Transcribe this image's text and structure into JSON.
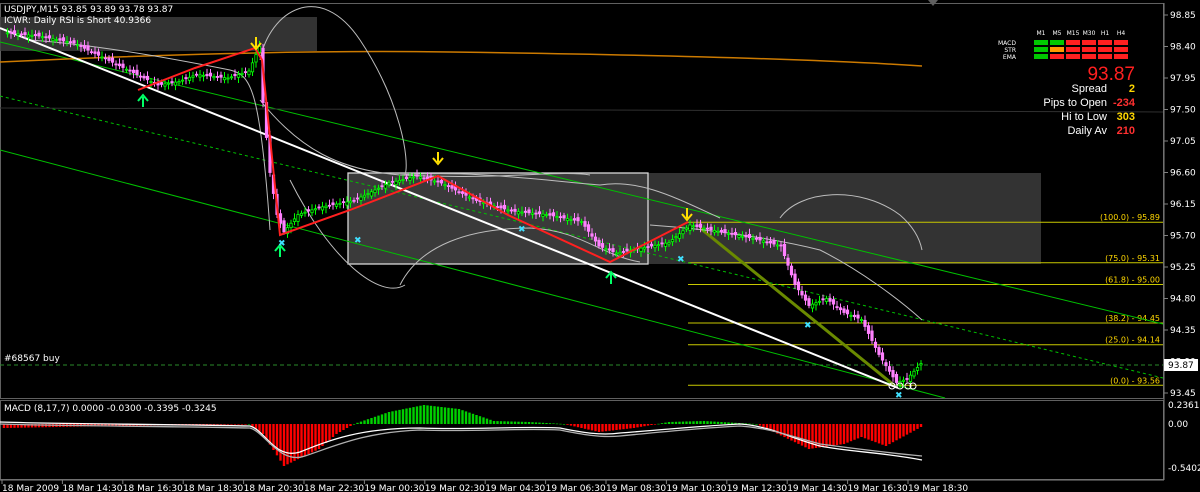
{
  "header": {
    "symbol_line": "USDJPY,M15  93.85 93.89 93.78 93.87",
    "rsi_line": "ICWR: Daily RSI is Short 40.9366"
  },
  "order_label": "#68567 buy",
  "macd": {
    "label": "MACD  (8,17,7) 0.0000 -0.0300 -0.3395 -0.3245",
    "axis": [
      "0.2361",
      "0.00",
      "-0.5402"
    ]
  },
  "panel": {
    "timeframes": [
      "M1",
      "M5",
      "M15",
      "M30",
      "H1",
      "H4"
    ],
    "rows": [
      {
        "name": "MACD",
        "colors": [
          "#00c800",
          "#00c800",
          "#ff2020",
          "#ff2020",
          "#ff2020",
          "#ff2020"
        ]
      },
      {
        "name": "STR",
        "colors": [
          "#00c800",
          "#ff9900",
          "#ff2020",
          "#ff2020",
          "#ff2020",
          "#ff2020"
        ]
      },
      {
        "name": "EMA",
        "colors": [
          "#00c800",
          "#ff2020",
          "#ff2020",
          "#ff2020",
          "#ff2020",
          "#ff2020"
        ]
      }
    ],
    "price": "93.87",
    "stats": [
      {
        "label": "Spread",
        "value": "2",
        "color": "#ffd700"
      },
      {
        "label": "Pips to Open",
        "value": "-234",
        "color": "#ff3030"
      },
      {
        "label": "Hi to Low",
        "value": "303",
        "color": "#ffd700"
      },
      {
        "label": "Daily Av",
        "value": "210",
        "color": "#ff3030"
      }
    ]
  },
  "fib_levels": [
    {
      "label": "(100.0) - 95.89",
      "price": 95.89
    },
    {
      "label": "(75.0) - 95.31",
      "price": 95.31
    },
    {
      "label": "(61.8) - 95.00",
      "price": 95.0
    },
    {
      "label": "(38.2) - 94.45",
      "price": 94.45
    },
    {
      "label": "(25.0) - 94.14",
      "price": 94.14
    },
    {
      "label": "(0.0) - 93.56",
      "price": 93.56
    }
  ],
  "colors": {
    "bull": "#00ff00",
    "bear": "#ff80ff",
    "zigzag": "#ff2020",
    "trend": "#00c000",
    "fib": "#c8c800",
    "ema": "#cc7a00",
    "macd_pos": "#00d000",
    "macd_neg": "#ff0000"
  },
  "chart_data": {
    "type": "candlestick",
    "price_axis": [
      "98.85",
      "98.40",
      "97.95",
      "97.50",
      "97.05",
      "96.60",
      "96.15",
      "95.70",
      "95.25",
      "94.80",
      "94.35",
      "93.90",
      "93.45"
    ],
    "price_tag": "93.87",
    "time_axis": [
      "18 Mar 2009",
      "18 Mar 14:30",
      "18 Mar 16:30",
      "18 Mar 18:30",
      "18 Mar 20:30",
      "18 Mar 22:30",
      "19 Mar 00:30",
      "19 Mar 02:30",
      "19 Mar 04:30",
      "19 Mar 06:30",
      "19 Mar 08:30",
      "19 Mar 10:30",
      "19 Mar 12:30",
      "19 Mar 14:30",
      "19 Mar 16:30",
      "19 Mar 18:30"
    ],
    "ylim": [
      93.3,
      98.95
    ],
    "price_series": [
      {
        "x": 0,
        "price": 98.6
      },
      {
        "x": 10,
        "price": 98.55
      },
      {
        "x": 20,
        "price": 98.45
      },
      {
        "x": 30,
        "price": 98.2
      },
      {
        "x": 40,
        "price": 97.95
      },
      {
        "x": 44,
        "price": 97.85
      },
      {
        "x": 50,
        "price": 97.9
      },
      {
        "x": 55,
        "price": 98.0
      },
      {
        "x": 64,
        "price": 97.95
      },
      {
        "x": 70,
        "price": 98.05
      },
      {
        "x": 73,
        "price": 98.4
      },
      {
        "x": 74,
        "price": 97.6
      },
      {
        "x": 76,
        "price": 96.6
      },
      {
        "x": 78,
        "price": 96.0
      },
      {
        "x": 80,
        "price": 95.75
      },
      {
        "x": 84,
        "price": 96.0
      },
      {
        "x": 90,
        "price": 96.1
      },
      {
        "x": 100,
        "price": 96.2
      },
      {
        "x": 110,
        "price": 96.45
      },
      {
        "x": 118,
        "price": 96.55
      },
      {
        "x": 125,
        "price": 96.45
      },
      {
        "x": 135,
        "price": 96.2
      },
      {
        "x": 145,
        "price": 96.05
      },
      {
        "x": 155,
        "price": 96.0
      },
      {
        "x": 165,
        "price": 95.9
      },
      {
        "x": 170,
        "price": 95.55
      },
      {
        "x": 175,
        "price": 95.45
      },
      {
        "x": 185,
        "price": 95.55
      },
      {
        "x": 190,
        "price": 95.6
      },
      {
        "x": 196,
        "price": 95.85
      },
      {
        "x": 205,
        "price": 95.75
      },
      {
        "x": 215,
        "price": 95.65
      },
      {
        "x": 222,
        "price": 95.55
      },
      {
        "x": 226,
        "price": 95.0
      },
      {
        "x": 230,
        "price": 94.7
      },
      {
        "x": 235,
        "price": 94.8
      },
      {
        "x": 240,
        "price": 94.6
      },
      {
        "x": 245,
        "price": 94.5
      },
      {
        "x": 250,
        "price": 94.0
      },
      {
        "x": 255,
        "price": 93.6
      },
      {
        "x": 258,
        "price": 93.65
      },
      {
        "x": 262,
        "price": 93.87
      }
    ],
    "macd_hist": [
      {
        "x": 0,
        "value": -0.04
      },
      {
        "x": 30,
        "value": -0.02
      },
      {
        "x": 70,
        "value": 0.0
      },
      {
        "x": 74,
        "value": -0.1
      },
      {
        "x": 80,
        "value": -0.42
      },
      {
        "x": 90,
        "value": -0.25
      },
      {
        "x": 95,
        "value": -0.1
      },
      {
        "x": 100,
        "value": 0.0
      },
      {
        "x": 110,
        "value": 0.12
      },
      {
        "x": 120,
        "value": 0.19
      },
      {
        "x": 130,
        "value": 0.15
      },
      {
        "x": 140,
        "value": 0.03
      },
      {
        "x": 150,
        "value": 0.02
      },
      {
        "x": 160,
        "value": 0.0
      },
      {
        "x": 170,
        "value": -0.08
      },
      {
        "x": 180,
        "value": -0.04
      },
      {
        "x": 190,
        "value": 0.02
      },
      {
        "x": 200,
        "value": 0.03
      },
      {
        "x": 215,
        "value": 0.0
      },
      {
        "x": 220,
        "value": -0.08
      },
      {
        "x": 230,
        "value": -0.25
      },
      {
        "x": 240,
        "value": -0.2
      },
      {
        "x": 245,
        "value": -0.13
      },
      {
        "x": 252,
        "value": -0.22
      },
      {
        "x": 262,
        "value": -0.03
      }
    ]
  }
}
